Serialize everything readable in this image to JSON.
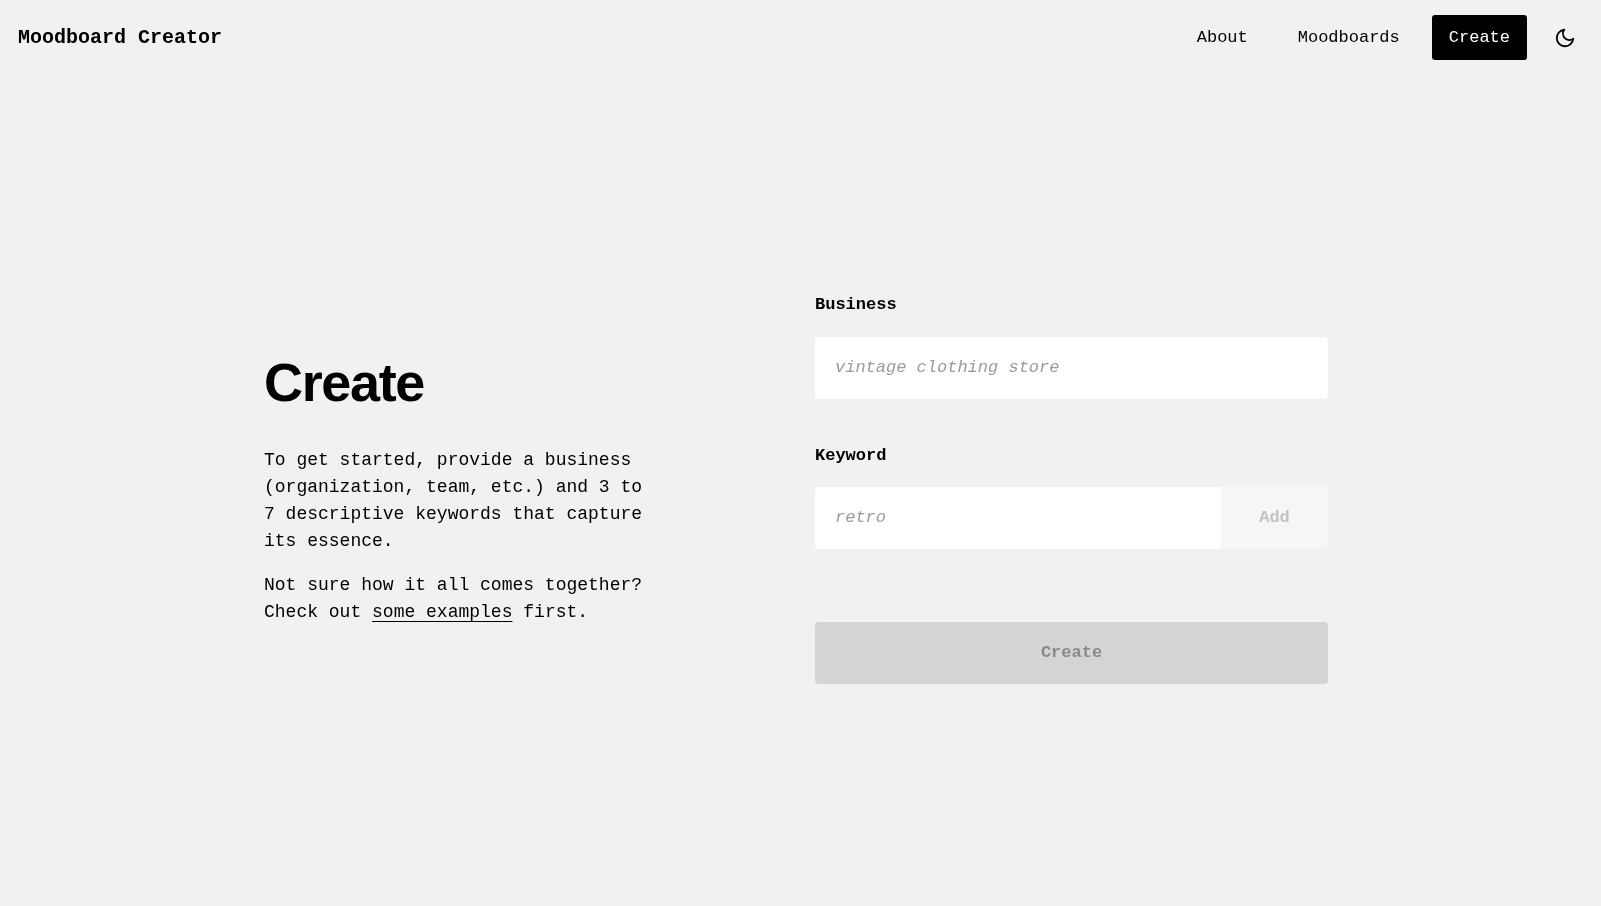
{
  "app_title": "Moodboard Creator",
  "nav": [
    {
      "label": "About",
      "selected": false
    },
    {
      "label": "Moodboards",
      "selected": false
    },
    {
      "label": "Create",
      "selected": true
    }
  ],
  "heading": "Create",
  "intro": "To get started, provide a business (organization, team, etc.) and 3 to 7 descriptive keywords that capture its essence.",
  "help": {
    "before": "Not sure how it all comes together? Check out",
    "link": "some examples",
    "after": "first."
  },
  "fields": [
    {
      "label": "Business",
      "placeholder": "vintage clothing store"
    },
    {
      "label": "Keyword",
      "placeholder": "retro",
      "button": {
        "label": "Add",
        "disabled": true
      }
    }
  ],
  "submit": {
    "label": "Create",
    "disabled": true
  }
}
